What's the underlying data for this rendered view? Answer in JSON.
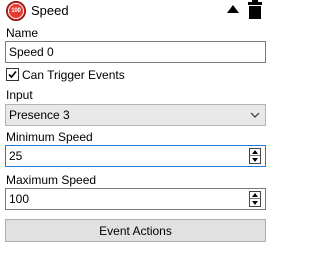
{
  "header": {
    "badge_text": "100",
    "title": "Speed",
    "collapse_icon": "triangle-up-icon",
    "delete_icon": "trash-icon",
    "badge_color": "#c8201c"
  },
  "name": {
    "label": "Name",
    "value": "Speed 0"
  },
  "can_trigger_events": {
    "label": "Can Trigger Events",
    "checked": true
  },
  "input": {
    "label": "Input",
    "selected": "Presence 3"
  },
  "minimum_speed": {
    "label": "Minimum Speed",
    "value": "25"
  },
  "maximum_speed": {
    "label": "Maximum Speed",
    "value": "100"
  },
  "event_actions": {
    "label": "Event Actions"
  },
  "colors": {
    "focus_border": "#1e7dd6"
  }
}
